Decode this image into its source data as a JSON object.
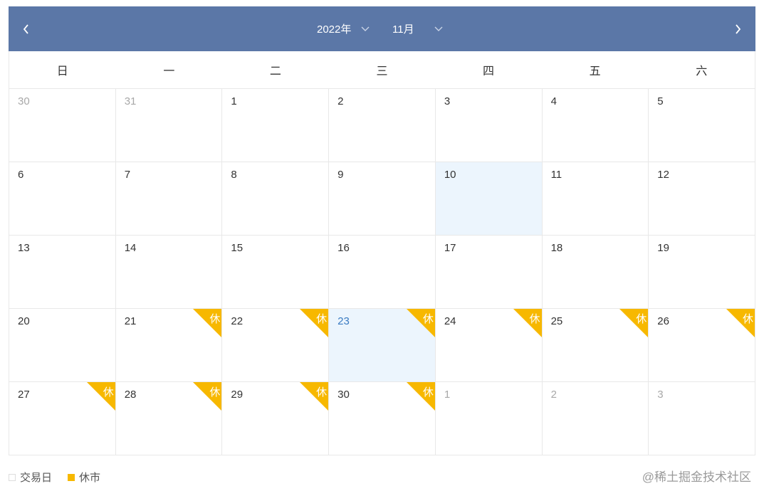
{
  "header": {
    "year": "2022年",
    "month": "11月",
    "prev_icon": "chevron-left-icon",
    "next_icon": "chevron-right-icon",
    "dropdown_icon": "chevron-down-icon"
  },
  "weekdays": [
    "日",
    "一",
    "二",
    "三",
    "四",
    "五",
    "六"
  ],
  "days": [
    {
      "n": "30",
      "other": true
    },
    {
      "n": "31",
      "other": true
    },
    {
      "n": "1"
    },
    {
      "n": "2"
    },
    {
      "n": "3"
    },
    {
      "n": "4"
    },
    {
      "n": "5"
    },
    {
      "n": "6"
    },
    {
      "n": "7"
    },
    {
      "n": "8"
    },
    {
      "n": "9"
    },
    {
      "n": "10",
      "today": true
    },
    {
      "n": "11"
    },
    {
      "n": "12"
    },
    {
      "n": "13"
    },
    {
      "n": "14"
    },
    {
      "n": "15"
    },
    {
      "n": "16"
    },
    {
      "n": "17"
    },
    {
      "n": "18"
    },
    {
      "n": "19"
    },
    {
      "n": "20"
    },
    {
      "n": "21",
      "rest": true
    },
    {
      "n": "22",
      "rest": true
    },
    {
      "n": "23",
      "rest": true,
      "selected": true
    },
    {
      "n": "24",
      "rest": true
    },
    {
      "n": "25",
      "rest": true
    },
    {
      "n": "26",
      "rest": true
    },
    {
      "n": "27",
      "rest": true
    },
    {
      "n": "28",
      "rest": true
    },
    {
      "n": "29",
      "rest": true
    },
    {
      "n": "30",
      "rest": true
    },
    {
      "n": "1",
      "other": true
    },
    {
      "n": "2",
      "other": true
    },
    {
      "n": "3",
      "other": true
    }
  ],
  "rest_label": "休",
  "legend": {
    "trading_day": "交易日",
    "market_closed": "休市"
  },
  "watermark": "@稀土掘金技术社区",
  "colors": {
    "header": "#5b77a7",
    "rest": "#f7b800",
    "highlight": "#ecf5fd"
  }
}
